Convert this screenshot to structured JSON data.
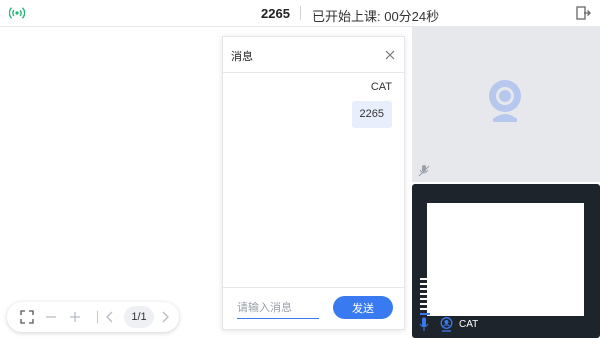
{
  "header": {
    "room_id": "2265",
    "class_status": "已开始上课: 00分24秒"
  },
  "toolbar": {
    "page_indicator": "1/1"
  },
  "chat": {
    "title": "消息",
    "messages": [
      {
        "sender": "CAT",
        "text": "2265"
      }
    ],
    "input_placeholder": "请输入消息",
    "input_value": "",
    "send_label": "发送"
  },
  "video": {
    "participant_name": "CAT",
    "volume_level": 0.125
  },
  "colors": {
    "accent": "#3a7af0",
    "signal": "#22b573",
    "video_bg": "#1e242c",
    "video_placeholder_bg": "#e7e8ec"
  }
}
